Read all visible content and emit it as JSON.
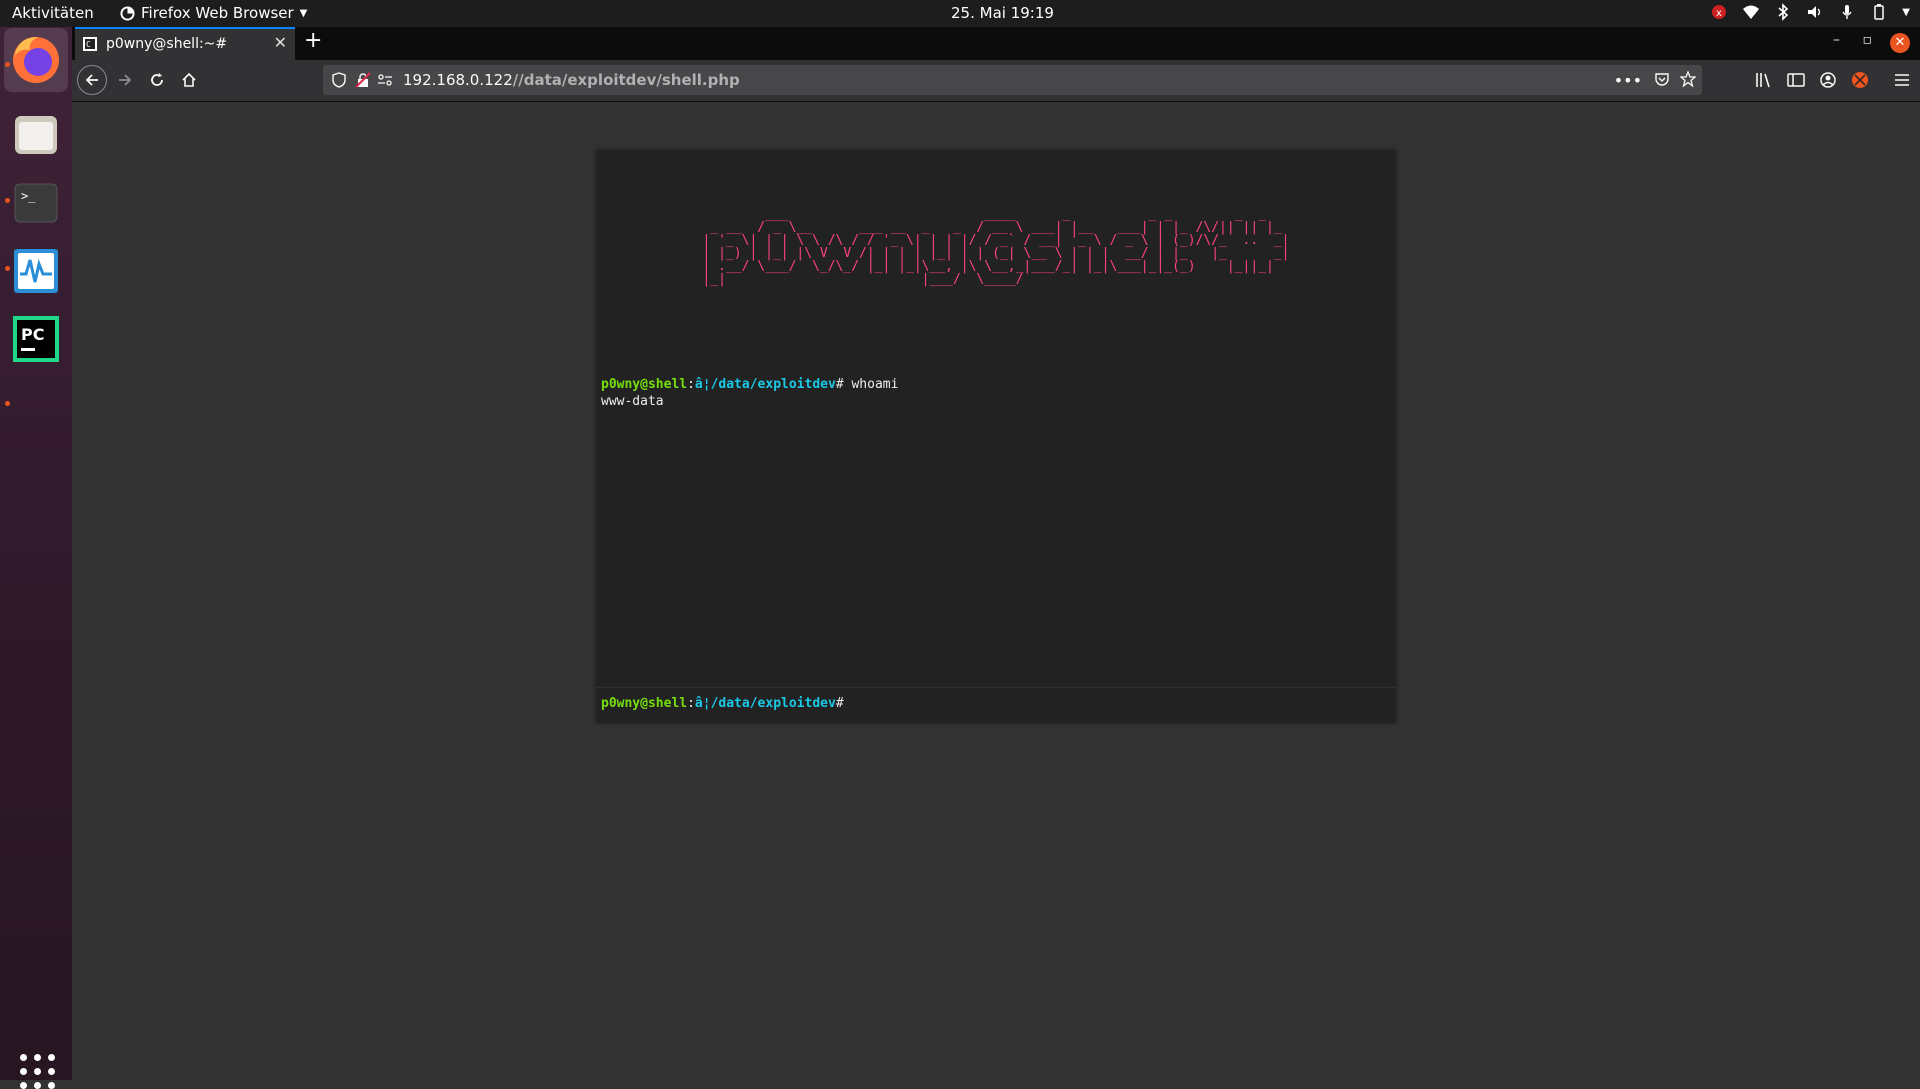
{
  "topbar": {
    "activities": "Aktivitäten",
    "app_menu": "Firefox Web Browser",
    "clock": "25. Mai  19:19"
  },
  "dock": {
    "items": [
      "firefox-icon",
      "files-icon",
      "terminal-icon",
      "system-monitor-icon",
      "pycharm-icon"
    ]
  },
  "browser": {
    "tab_title": "p0wny@shell:~#",
    "url_host": "192.168.0.122",
    "url_path": "//data/exploitdev/shell.php"
  },
  "shell": {
    "ascii_banner": "        ___                         ____      _          _ _        _  _   \n _ __  / _ \\__      ___ __  _   _  / __ \\ ___| |__   ___| | |_ /\\/|| || |_ \n| '_ \\| | | \\ \\ /\\ / / '_ \\| | | |/ / _` / __| '_ \\ / _ \\ | (_)/\\/_  ..  _|\n| |_) | |_| |\\ V  V /| | | | |_| | | (_| \\__ \\ | | |  __/ | |_   |_      _|\n| .__/ \\___/  \\_/\\_/ |_| |_|\\__, |\\ \\__,_|___/_| |_|\\___|_|_(_)    |_||_|  \n|_|                         |___/  \\____/                                  ",
    "history": [
      {
        "user": "p0wny@shell",
        "sep": ":",
        "path": "â¦/data/exploitdev",
        "symbol": "#",
        "command": "whoami",
        "output": "www-data"
      }
    ],
    "prompt": {
      "user": "p0wny@shell",
      "sep": ":",
      "path": "â¦/data/exploitdev",
      "symbol": "#"
    }
  },
  "colors": {
    "banner": "#ff4180",
    "user": "#75df0b",
    "path": "#1bc9e7",
    "accent": "#e95420"
  }
}
